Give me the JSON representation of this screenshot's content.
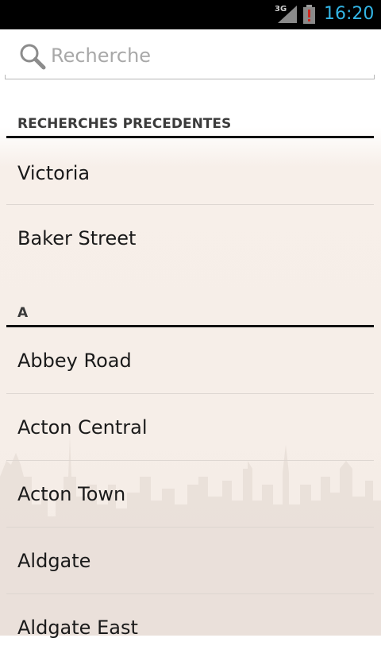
{
  "status_bar": {
    "network": "3G",
    "time": "16:20",
    "colors": {
      "time": "#33b5e5",
      "battery_alert": "#d0271d"
    }
  },
  "search": {
    "placeholder": "Recherche",
    "value": ""
  },
  "sections": [
    {
      "header": "RECHERCHES PRECEDENTES",
      "items": [
        "Victoria",
        "Baker Street"
      ]
    },
    {
      "header": "A",
      "items": [
        "Abbey Road",
        "Acton Central",
        "Acton Town",
        "Aldgate",
        "Aldgate East"
      ]
    }
  ]
}
